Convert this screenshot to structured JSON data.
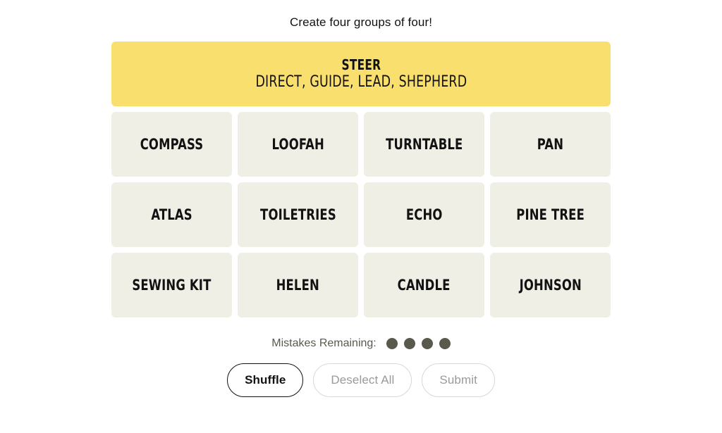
{
  "game": {
    "title": "Create four groups of four!"
  },
  "solved_groups": [
    {
      "category": "STEER",
      "members": "DIRECT, GUIDE, LEAD, SHEPHERD",
      "color": "#f9df6d"
    }
  ],
  "grid": {
    "rows": [
      {
        "tiles": [
          {
            "label": "COMPASS"
          },
          {
            "label": "LOOFAH"
          },
          {
            "label": "TURNTABLE"
          },
          {
            "label": "PAN"
          }
        ]
      },
      {
        "tiles": [
          {
            "label": "ATLAS"
          },
          {
            "label": "TOILETRIES"
          },
          {
            "label": "ECHO"
          },
          {
            "label": "PINE TREE"
          }
        ]
      },
      {
        "tiles": [
          {
            "label": "SEWING KIT"
          },
          {
            "label": "HELEN"
          },
          {
            "label": "CANDLE"
          },
          {
            "label": "JOHNSON"
          }
        ]
      }
    ]
  },
  "mistakes": {
    "label": "Mistakes Remaining:",
    "remaining": 4,
    "dot_color": "#5a594e"
  },
  "controls": {
    "shuffle": {
      "label": "Shuffle",
      "enabled": true
    },
    "deselect_all": {
      "label": "Deselect All",
      "enabled": false
    },
    "submit": {
      "label": "Submit",
      "enabled": false
    }
  },
  "theme": {
    "tile_background": "#efefe6",
    "text_color": "#121212",
    "muted_text": "#9a9a9a",
    "page_background": "#ffffff"
  }
}
